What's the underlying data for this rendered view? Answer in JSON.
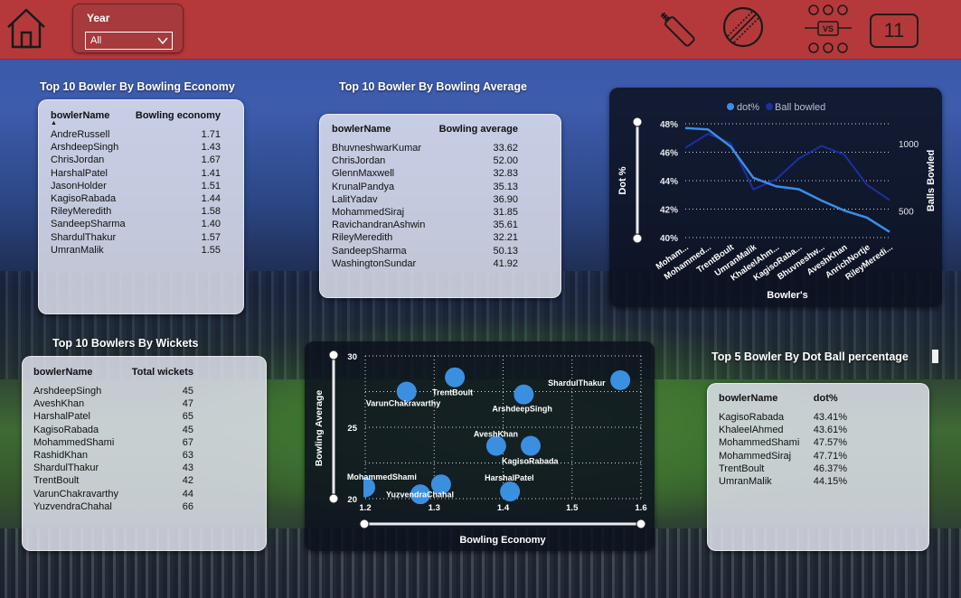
{
  "header": {
    "year_label": "Year",
    "year_value": "All",
    "eleven_label": "11"
  },
  "economy": {
    "title": "Top 10 Bowler By Bowling Economy",
    "columns": [
      "bowlerName",
      "Bowling economy"
    ],
    "rows": [
      [
        "AndreRussell",
        "1.71"
      ],
      [
        "ArshdeepSingh",
        "1.43"
      ],
      [
        "ChrisJordan",
        "1.67"
      ],
      [
        "HarshalPatel",
        "1.41"
      ],
      [
        "JasonHolder",
        "1.51"
      ],
      [
        "KagisoRabada",
        "1.44"
      ],
      [
        "RileyMeredith",
        "1.58"
      ],
      [
        "SandeepSharma",
        "1.40"
      ],
      [
        "ShardulThakur",
        "1.57"
      ],
      [
        "UmranMalik",
        "1.55"
      ]
    ]
  },
  "average": {
    "title": "Top 10 Bowler By Bowling Average",
    "columns": [
      "bowlerName",
      "Bowling average"
    ],
    "rows": [
      [
        "BhuvneshwarKumar",
        "33.62"
      ],
      [
        "ChrisJordan",
        "52.00"
      ],
      [
        "GlennMaxwell",
        "32.83"
      ],
      [
        "KrunalPandya",
        "35.13"
      ],
      [
        "LalitYadav",
        "36.90"
      ],
      [
        "MohammedSiraj",
        "31.85"
      ],
      [
        "RavichandranAshwin",
        "35.61"
      ],
      [
        "RileyMeredith",
        "32.21"
      ],
      [
        "SandeepSharma",
        "50.13"
      ],
      [
        "WashingtonSundar",
        "41.92"
      ]
    ]
  },
  "wickets": {
    "title": "Top 10 Bowlers By  Wickets",
    "columns": [
      "bowlerName",
      "Total wickets"
    ],
    "rows": [
      [
        "ArshdeepSingh",
        "45"
      ],
      [
        "AveshKhan",
        "47"
      ],
      [
        "HarshalPatel",
        "65"
      ],
      [
        "KagisoRabada",
        "45"
      ],
      [
        "MohammedShami",
        "67"
      ],
      [
        "RashidKhan",
        "63"
      ],
      [
        "ShardulThakur",
        "43"
      ],
      [
        "TrentBoult",
        "42"
      ],
      [
        "VarunChakravarthy",
        "44"
      ],
      [
        "YuzvendraChahal",
        "66"
      ]
    ]
  },
  "dotball": {
    "title": "Top 5 Bowler By Dot Ball percentage",
    "columns": [
      "bowlerName",
      "dot%"
    ],
    "rows": [
      [
        "KagisoRabada",
        "43.41%"
      ],
      [
        "KhaleelAhmed",
        "43.61%"
      ],
      [
        "MohammedShami",
        "47.57%"
      ],
      [
        "MohammedSiraj",
        "47.71%"
      ],
      [
        "TrentBoult",
        "46.37%"
      ],
      [
        "UmranMalik",
        "44.15%"
      ]
    ]
  },
  "colors": {
    "header_red": "#b5393b",
    "dot_line": "#3a8ee6",
    "balls_line": "#1e2fa0",
    "scatter_point": "#3b8fe0"
  },
  "chart_data": [
    {
      "type": "line",
      "title": "",
      "legend": [
        "dot%",
        "Ball bowled"
      ],
      "legend_position": "top",
      "xlabel": "Bowler's",
      "ylabel": "Dot %",
      "y2label": "Balls Bowled",
      "ylim": [
        40,
        48
      ],
      "y_ticks": [
        "48%",
        "46%",
        "44%",
        "42%",
        "40%"
      ],
      "y2_ticks": [
        "1000",
        "500"
      ],
      "categories": [
        "Moham...",
        "Mohammed...",
        "TrentBoult",
        "UmranMalik",
        "KhaleelAhm...",
        "KagisoRaba...",
        "Bhuvneshw...",
        "AveshKhan",
        "AnrichNortje",
        "RileyMeredi..."
      ],
      "series": [
        {
          "name": "dot%",
          "axis": "left",
          "values": [
            47.7,
            47.6,
            46.4,
            44.2,
            43.6,
            43.4,
            42.6,
            41.9,
            41.4,
            40.4
          ]
        },
        {
          "name": "Ball bowled",
          "axis": "right",
          "values": [
            970,
            1075,
            1005,
            660,
            735,
            890,
            985,
            920,
            695,
            580
          ]
        }
      ]
    },
    {
      "type": "scatter",
      "xlabel": "Bowling Economy",
      "ylabel": "Bowling Average",
      "xlim": [
        1.2,
        1.6
      ],
      "ylim": [
        20,
        30
      ],
      "x_ticks": [
        "1.2",
        "1.3",
        "1.4",
        "1.5",
        "1.6"
      ],
      "y_ticks": [
        "30",
        "25",
        "20"
      ],
      "points": [
        {
          "label": "VarunChakravarthy",
          "x": 1.26,
          "y": 27.5
        },
        {
          "label": "TrentBoult",
          "x": 1.33,
          "y": 28.5
        },
        {
          "label": "ShardulThakur",
          "x": 1.57,
          "y": 28.3
        },
        {
          "label": "ArshdeepSingh",
          "x": 1.43,
          "y": 27.3
        },
        {
          "label": "AveshKhan",
          "x": 1.39,
          "y": 23.7
        },
        {
          "label": "KagisoRabada",
          "x": 1.44,
          "y": 23.7
        },
        {
          "label": "MohammedShami",
          "x": 1.31,
          "y": 21.0
        },
        {
          "label": "HarshalPatel",
          "x": 1.41,
          "y": 20.5
        },
        {
          "label": "YuzvendraChahal",
          "x": 1.28,
          "y": 20.3
        },
        {
          "label": "",
          "x": 1.2,
          "y": 20.8
        }
      ]
    }
  ]
}
